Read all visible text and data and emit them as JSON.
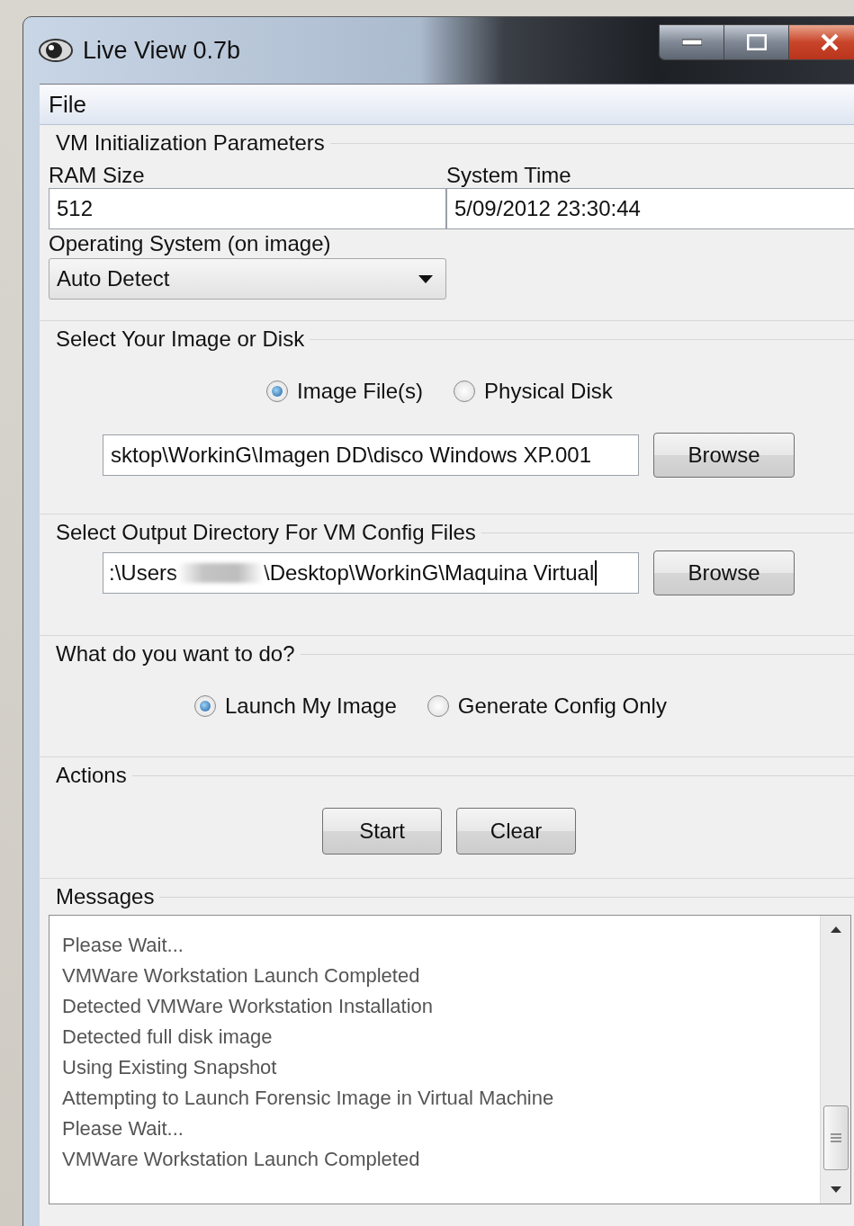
{
  "window": {
    "title": "Live View 0.7b"
  },
  "menu": [
    {
      "label": "File"
    }
  ],
  "vm_parameters": {
    "title": "VM Initialization Parameters",
    "ram": {
      "label": "RAM Size",
      "value": "512"
    },
    "system_time": {
      "label": "System Time",
      "value": "5/09/2012 23:30:44"
    },
    "os": {
      "label": "Operating System (on image)",
      "value": "Auto Detect"
    }
  },
  "image_source": {
    "title": "Select Your Image or Disk",
    "options": [
      {
        "label": "Image File(s)",
        "selected": true
      },
      {
        "label": "Physical Disk",
        "selected": false
      }
    ],
    "path": "sktop\\WorkinG\\Imagen DD\\disco Windows XP.001",
    "browse": "Browse"
  },
  "output": {
    "title": "Select Output Directory For VM Config Files",
    "path_parts": [
      ":\\Users",
      "\\Desktop\\WorkinG\\Maquina Virtual"
    ],
    "browse": "Browse"
  },
  "mode": {
    "title": "What do you want to do?",
    "options": [
      {
        "label": "Launch My Image",
        "selected": true
      },
      {
        "label": "Generate Config Only",
        "selected": false
      }
    ]
  },
  "actions": {
    "title": "Actions",
    "buttons": [
      "Start",
      "Clear"
    ]
  },
  "messages": {
    "title": "Messages",
    "lines": [
      "Please Wait...",
      "VMWare Workstation Launch Completed",
      "Detected VMWare Workstation Installation",
      "Detected full disk image",
      "Using Existing Snapshot",
      "Attempting to Launch Forensic Image in Virtual Machine",
      "Please Wait...",
      "VMWare Workstation Launch Completed"
    ]
  }
}
